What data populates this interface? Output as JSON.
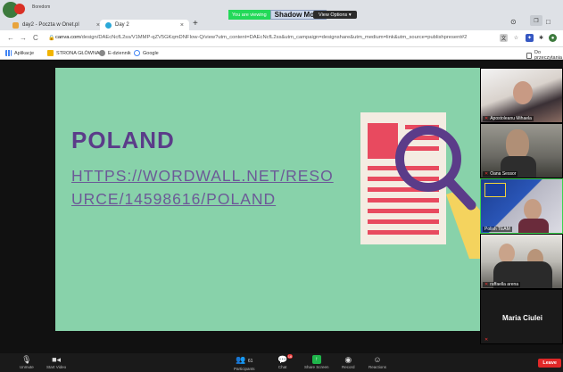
{
  "browser": {
    "profile_name": "Boredom",
    "tabs": [
      {
        "label": "day2 - Poczta w Onet.pl",
        "close": "×"
      },
      {
        "label": "Day 2",
        "close": "×"
      }
    ],
    "new_tab": "+",
    "url_host": "canva.com",
    "url_path": "/design/DAEcNcfL2ss/V1MMP-qZV5GKqmDNFIow-Q/view?utm_content=DAEcNcfL2ss&utm_campaign=designshare&utm_medium=link&utm_source=publishpresent#2",
    "bookmarks": [
      {
        "label": "Aplikacje"
      },
      {
        "label": "STRONA GŁÓWNA"
      },
      {
        "label": "E-dziennik"
      },
      {
        "label": "Google"
      },
      {
        "label": "Do przeczytania"
      }
    ]
  },
  "zoom_banner": {
    "viewing_label": "You are viewing",
    "mode_label": "Shadow Mode",
    "view_options_label": "View Options ▾"
  },
  "slide": {
    "title": "POLAND",
    "link": "HTTPS://WORDWALL.NET/RESOURCE/14598616/POLAND"
  },
  "participants": [
    {
      "name": "Apostoleanu Mihaela",
      "active": false
    },
    {
      "name": "Oana Sessor",
      "active": false
    },
    {
      "name": "Polish TEAM",
      "active": true
    },
    {
      "name": "raffaella arena",
      "active": false
    },
    {
      "name": "Maria Ciulei",
      "active": false
    }
  ],
  "toolbar": {
    "unmute": "Unmute",
    "start_video": "Start Video",
    "participants": "Participants",
    "participants_count": "61",
    "chat": "Chat",
    "chat_badge": "16",
    "share_screen": "Share Screen",
    "record": "Record",
    "reactions": "Reactions",
    "leave": "Leave"
  },
  "colors": {
    "slide_bg": "#88d2aa",
    "slide_title": "#5b3c89",
    "slide_link": "#6c5a97",
    "zoom_green": "#23d959",
    "leave_red": "#e02828"
  }
}
